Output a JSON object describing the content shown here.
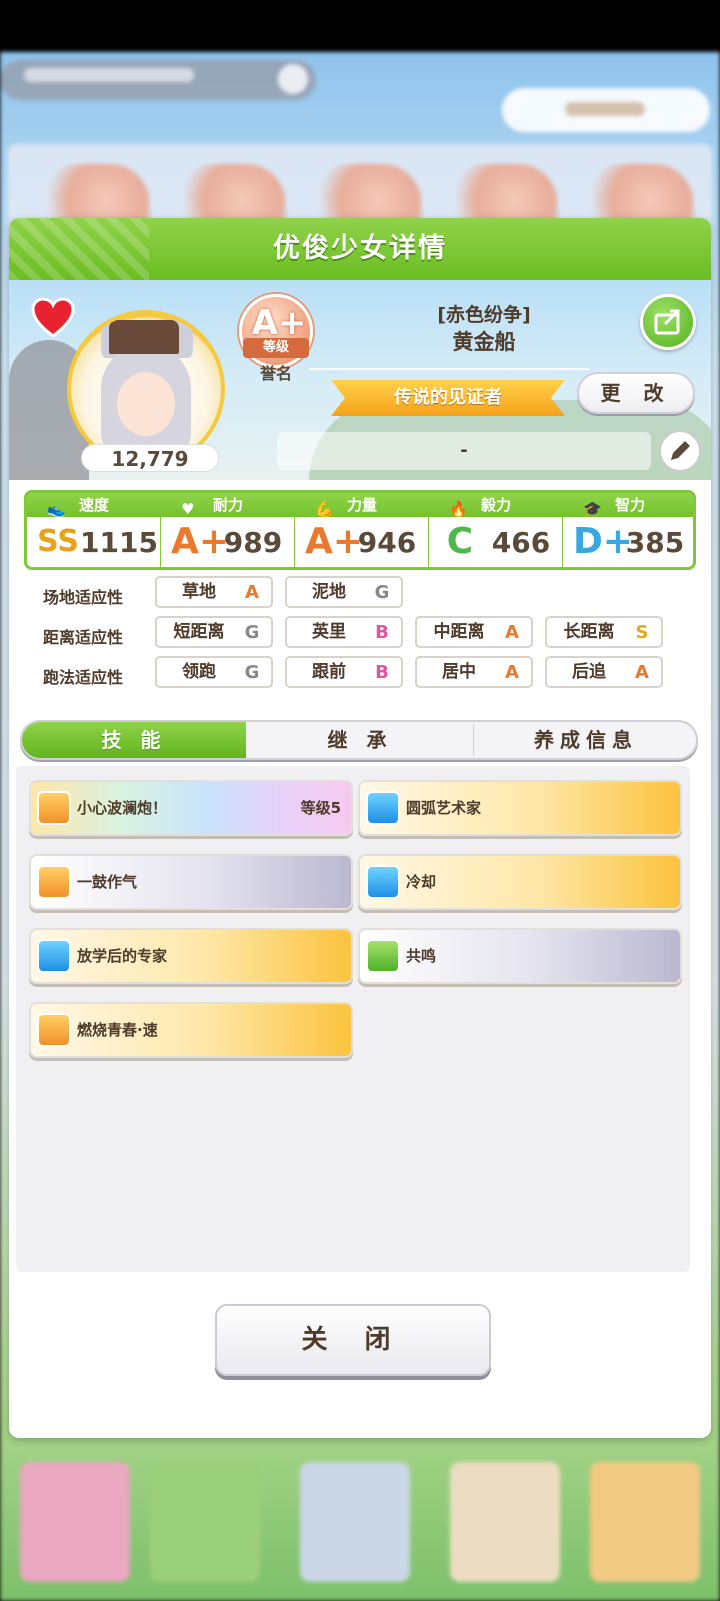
{
  "dialog": {
    "title": "优俊少女详情"
  },
  "profile": {
    "epithet": "[赤色纷争]",
    "name": "黄金船",
    "fans": "12,779",
    "rank": {
      "grade": "A+",
      "ribbon": "等级",
      "label": "誉名"
    },
    "title_banner": "传说的见证者",
    "change_label": "更 改",
    "comment": "-"
  },
  "stats": [
    {
      "label": "速度",
      "grade": "SS",
      "value": "1115",
      "icon": "shoe-icon",
      "color": "#e7a21a"
    },
    {
      "label": "耐力",
      "grade": "A+",
      "value": "989",
      "icon": "heart-icon",
      "color": "#e9792c"
    },
    {
      "label": "力量",
      "grade": "A+",
      "value": "946",
      "icon": "muscle-icon",
      "color": "#e9792c"
    },
    {
      "label": "毅力",
      "grade": "C",
      "value": "466",
      "icon": "flame-icon",
      "color": "#4cb94a"
    },
    {
      "label": "智力",
      "grade": "D+",
      "value": "385",
      "icon": "graduation-cap-icon",
      "color": "#3aa8e0"
    }
  ],
  "aptitude": {
    "track": {
      "label": "场地适应性",
      "items": [
        {
          "name": "草地",
          "grade": "A"
        },
        {
          "name": "泥地",
          "grade": "G"
        }
      ]
    },
    "distance": {
      "label": "距离适应性",
      "items": [
        {
          "name": "短距离",
          "grade": "G"
        },
        {
          "name": "英里",
          "grade": "B"
        },
        {
          "name": "中距离",
          "grade": "A"
        },
        {
          "name": "长距离",
          "grade": "S"
        }
      ]
    },
    "style": {
      "label": "跑法适应性",
      "items": [
        {
          "name": "领跑",
          "grade": "G"
        },
        {
          "name": "跟前",
          "grade": "B"
        },
        {
          "name": "居中",
          "grade": "A"
        },
        {
          "name": "后追",
          "grade": "A"
        }
      ]
    }
  },
  "tabs": [
    {
      "label": "技 能",
      "active": true
    },
    {
      "label": "继 承"
    },
    {
      "label": "养成信息"
    }
  ],
  "skills": [
    {
      "name": "小心波澜炮！",
      "level": "等级5",
      "style": "rainbow",
      "icon": "horse-skill-icon"
    },
    {
      "name": "圆弧艺术家",
      "style": "gold",
      "icon": "sparkle-skill-icon"
    },
    {
      "name": "一鼓作气",
      "style": "white",
      "icon": "horse-skill-icon"
    },
    {
      "name": "冷却",
      "style": "gold",
      "icon": "sparkle-skill-icon"
    },
    {
      "name": "放学后的专家",
      "style": "gold",
      "icon": "sparkle-skill-icon"
    },
    {
      "name": "共鸣",
      "style": "white",
      "icon": "card-skill-icon"
    },
    {
      "name": "燃烧青春·速",
      "style": "gold",
      "icon": "horse-skill-icon"
    }
  ],
  "close_label": "关 闭"
}
